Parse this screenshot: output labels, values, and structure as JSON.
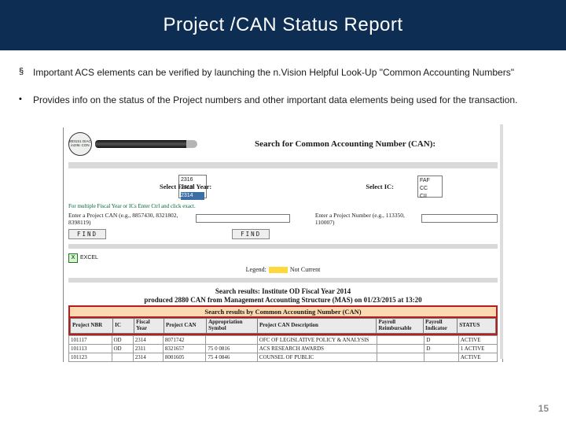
{
  "title": "Project /CAN Status Report",
  "bullets": [
    "Important ACS elements can be verified by launching the n.Vision Helpful Look-Up \"Common Accounting Numbers\"",
    "Provides info on the status of the Project numbers and other important data elements being used for the transaction."
  ],
  "shot": {
    "logo_text": "8031S1 DIAC in2!8c CON",
    "search_heading": "Search for Common Accounting Number (CAN):",
    "fy_label": "Select Fiscal Year:",
    "fy_options": [
      "2316",
      "2319",
      "2314"
    ],
    "ic_label": "Select IC:",
    "ic_options": [
      "FAF",
      "CC",
      "CII"
    ],
    "hint": "For multiple Fiscal Year or ICs Enter Ctrl and click exact.",
    "can_label": "Enter a Project CAN (e.g., 8857430, 8321802, 8398119)",
    "proj_label": "Enter a Project Number (e.g., 113350, 110007)",
    "find_btn": "FIND",
    "excel_label": "EXCEL",
    "legend_label": "Legend:",
    "legend_value": "Not Current",
    "results_line1": "Search results: Institute OD Fiscal Year 2014",
    "results_line2": "produced 2880 CAN from Management Accounting Structure (MAS) on 01/23/2015 at 13:20",
    "section_header": "Search results by Common Accounting Number (CAN)",
    "columns": [
      "Project NBR",
      "IC",
      "Fiscal Year",
      "Project CAN",
      "Appropriation Symbol",
      "Project CAN Description",
      "Payroll Reimbursable",
      "Payroll Indicator",
      "STATUS"
    ],
    "rows": [
      {
        "nbr": "101117",
        "ic": "OD",
        "fy": "2314",
        "can": "8071742",
        "sym": "",
        "desc": "OFC OF LEGISLATIVE POLICY & ANALYSIS",
        "reimb": "",
        "ind": "D",
        "status": "ACTIVE"
      },
      {
        "nbr": "101113",
        "ic": "OD",
        "fy": "2311",
        "can": "8321657",
        "sym": "75 0 0816",
        "desc": "ACS RESEARCH AWARDS",
        "reimb": "",
        "ind": "D",
        "status": "1 ACTIVE"
      },
      {
        "nbr": "101123",
        "ic": "",
        "fy": "2314",
        "can": "8001605",
        "sym": "75 4 0846",
        "desc": "COUNSEL OF PUBLIC",
        "reimb": "",
        "ind": "",
        "status": "ACTIVE"
      }
    ]
  },
  "page_number": "15"
}
